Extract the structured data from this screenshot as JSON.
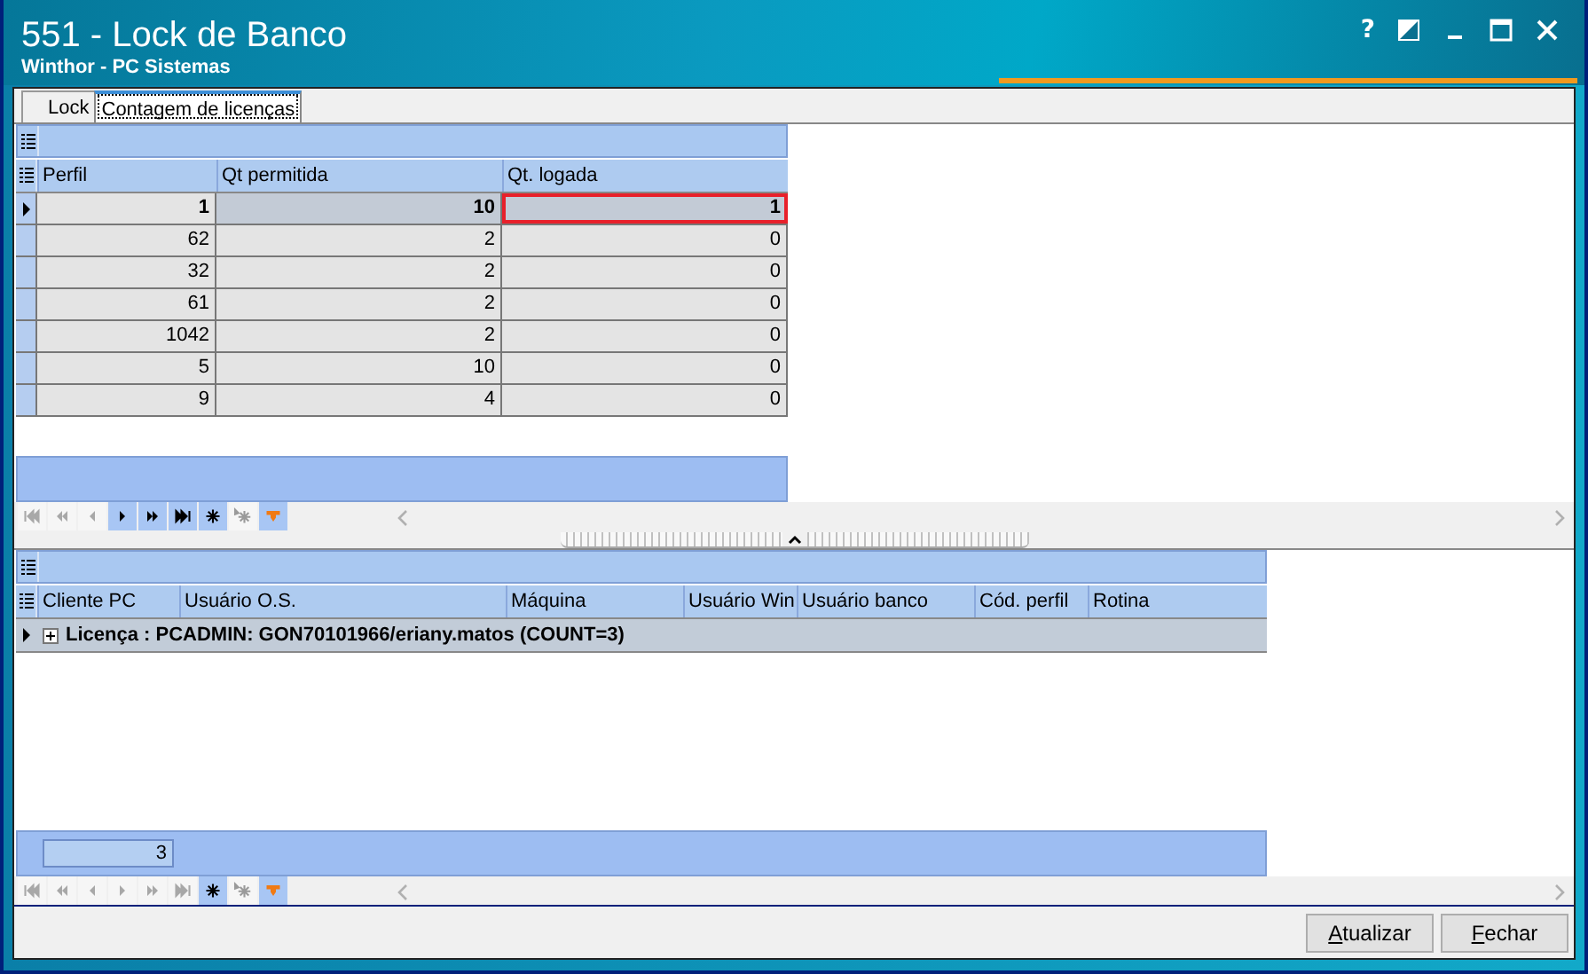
{
  "window": {
    "title": "551 - Lock de Banco",
    "subtitle": "Winthor - PC Sistemas",
    "help": "?"
  },
  "tabs": [
    {
      "label": "Lock",
      "selected": false
    },
    {
      "label": "Contagem de licenças",
      "selected": true
    }
  ],
  "upper_grid": {
    "columns": [
      "Perfil",
      "Qt permitida",
      "Qt. logada"
    ],
    "rows": [
      {
        "selected": true,
        "cells": [
          {
            "text": "1",
            "focused": false
          },
          {
            "text": "10",
            "focused": false
          },
          {
            "text": "1",
            "focused": true
          }
        ]
      },
      {
        "selected": false,
        "cells": [
          {
            "text": "62",
            "focused": false
          },
          {
            "text": "2",
            "focused": false
          },
          {
            "text": "0",
            "focused": false
          }
        ]
      },
      {
        "selected": false,
        "cells": [
          {
            "text": "32",
            "focused": false
          },
          {
            "text": "2",
            "focused": false
          },
          {
            "text": "0",
            "focused": false
          }
        ]
      },
      {
        "selected": false,
        "cells": [
          {
            "text": "61",
            "focused": false
          },
          {
            "text": "2",
            "focused": false
          },
          {
            "text": "0",
            "focused": false
          }
        ]
      },
      {
        "selected": false,
        "cells": [
          {
            "text": "1042",
            "focused": false
          },
          {
            "text": "2",
            "focused": false
          },
          {
            "text": "0",
            "focused": false
          }
        ]
      },
      {
        "selected": false,
        "cells": [
          {
            "text": "5",
            "focused": false
          },
          {
            "text": "10",
            "focused": false
          },
          {
            "text": "0",
            "focused": false
          }
        ]
      },
      {
        "selected": false,
        "cells": [
          {
            "text": "9",
            "focused": false
          },
          {
            "text": "4",
            "focused": false
          },
          {
            "text": "0",
            "focused": false
          }
        ]
      }
    ],
    "navigator": [
      {
        "kind": "first",
        "disabled": true
      },
      {
        "kind": "prior-page",
        "disabled": true
      },
      {
        "kind": "prior",
        "disabled": true
      },
      {
        "kind": "next",
        "disabled": false
      },
      {
        "kind": "next-page",
        "disabled": false
      },
      {
        "kind": "last",
        "disabled": false
      },
      {
        "kind": "insert",
        "disabled": false
      },
      {
        "kind": "insert-copy",
        "disabled": true
      },
      {
        "kind": "filter",
        "disabled": false
      }
    ]
  },
  "lower_grid": {
    "columns": [
      "Cliente PC",
      "Usuário O.S.",
      "Máquina",
      "Usuário Win",
      "Usuário banco",
      "Cód. perfil",
      "Rotina"
    ],
    "groups": [
      {
        "text": "Licença : PCADMIN: GON70101966/eriany.matos (COUNT=3)",
        "expanded": false,
        "selected": true
      }
    ],
    "footer_count": "3",
    "navigator": [
      {
        "kind": "first",
        "disabled": true
      },
      {
        "kind": "prior-page",
        "disabled": true
      },
      {
        "kind": "prior",
        "disabled": true
      },
      {
        "kind": "next",
        "disabled": true
      },
      {
        "kind": "next-page",
        "disabled": true
      },
      {
        "kind": "last",
        "disabled": true
      },
      {
        "kind": "insert",
        "disabled": false
      },
      {
        "kind": "insert-copy",
        "disabled": true
      },
      {
        "kind": "filter",
        "disabled": false
      }
    ]
  },
  "buttons": [
    "Atualizar",
    "Fechar"
  ]
}
